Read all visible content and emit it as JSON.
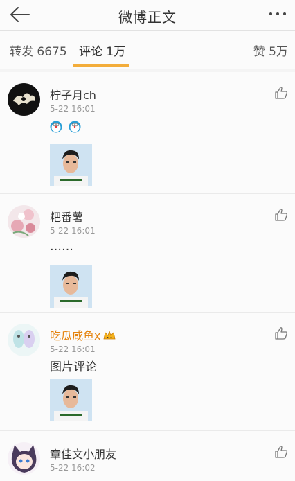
{
  "header": {
    "title": "微博正文",
    "back_icon": "arrow-left-icon",
    "more_icon": "more-dots-icon"
  },
  "tabs": {
    "repost": "转发 6675",
    "comment": "评论 1万",
    "like": "赞 5万",
    "active": "comment",
    "accent_color": "#f3ad3b"
  },
  "comments": [
    {
      "username": "柠子月ch",
      "time": "5-22 16:01",
      "text": "",
      "emoji": [
        "doraemon-icon",
        "doraemon-icon"
      ],
      "has_image": true
    },
    {
      "username": "粑番薯",
      "time": "5-22 16:01",
      "text": "……",
      "has_image": true
    },
    {
      "username": "吃瓜咸鱼x",
      "time": "5-22 16:01",
      "text": "图片评论",
      "has_image": true,
      "vip": true
    },
    {
      "username": "章佳文小朋友",
      "time": "5-22 16:02",
      "text": "",
      "has_image": false
    }
  ],
  "colors": {
    "vip_name": "#e5830d",
    "timestamp": "#999999"
  }
}
